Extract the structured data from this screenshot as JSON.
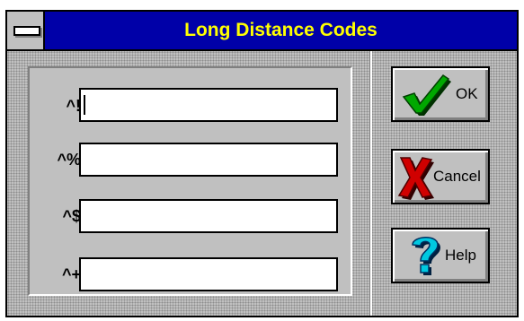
{
  "window": {
    "title": "Long Distance Codes"
  },
  "fields": [
    {
      "label": "^!",
      "value": ""
    },
    {
      "label": "^%",
      "value": ""
    },
    {
      "label": "^$",
      "value": ""
    },
    {
      "label": "^+",
      "value": ""
    }
  ],
  "buttons": {
    "ok": {
      "label": "OK",
      "icon": "checkmark-icon"
    },
    "cancel": {
      "label": "Cancel",
      "icon": "x-icon"
    },
    "help": {
      "label": "Help",
      "icon": "question-mark-icon"
    }
  },
  "colors": {
    "title_bar": "#0000a8",
    "title_text": "#ffff00",
    "face": "#c0c0c0",
    "check_green": "#00a800",
    "cancel_red": "#d00000",
    "help_cyan": "#00c8e0"
  }
}
